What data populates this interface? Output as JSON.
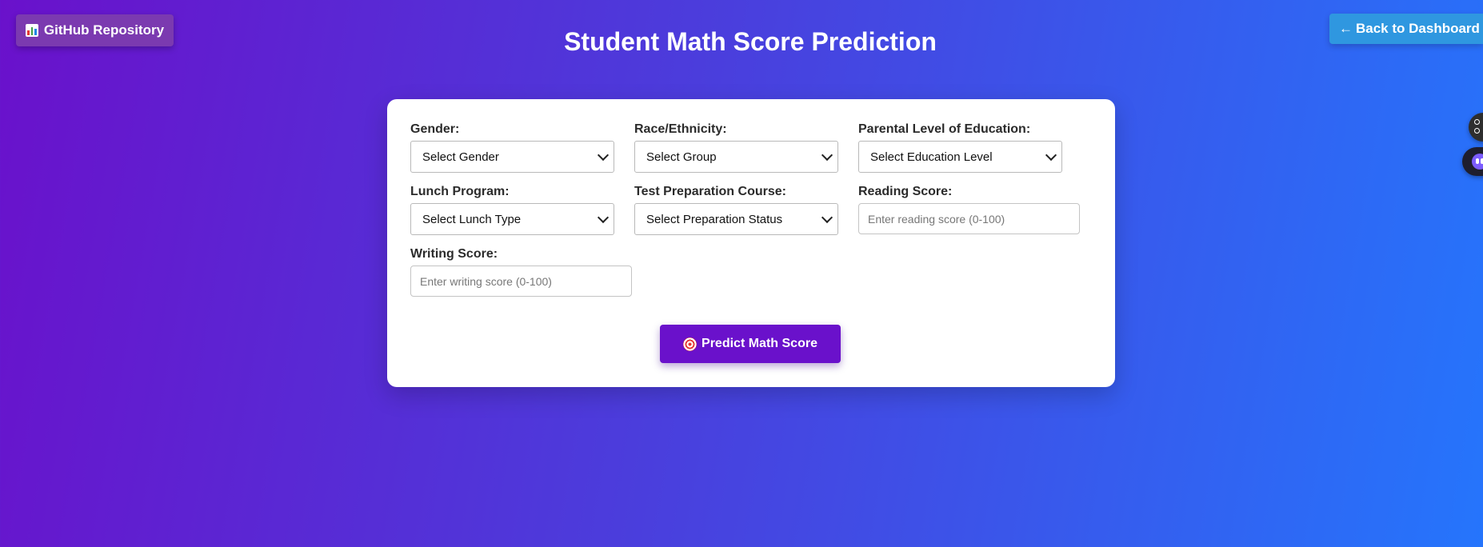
{
  "header": {
    "github_label": "GitHub Repository",
    "back_label": "Back to Dashboard",
    "back_arrow": "←",
    "title": "Student Math Score Prediction"
  },
  "form": {
    "gender": {
      "label": "Gender:",
      "selected": "Select Gender"
    },
    "race": {
      "label": "Race/Ethnicity:",
      "selected": "Select Group"
    },
    "parental": {
      "label": "Parental Level of Education:",
      "selected": "Select Education Level"
    },
    "lunch": {
      "label": "Lunch Program:",
      "selected": "Select Lunch Type"
    },
    "prep": {
      "label": "Test Preparation Course:",
      "selected": "Select Preparation Status"
    },
    "reading": {
      "label": "Reading Score:",
      "placeholder": "Enter reading score (0-100)",
      "value": ""
    },
    "writing": {
      "label": "Writing Score:",
      "placeholder": "Enter writing score (0-100)",
      "value": ""
    },
    "submit_label": "Predict Math Score"
  },
  "icons": {
    "github": "bar-chart-icon",
    "submit": "target-icon",
    "side_widget_1": "widget-menu-icon",
    "side_widget_2": "assistant-bot-icon"
  },
  "colors": {
    "gradient_start": "#6a11cb",
    "gradient_end": "#2575fc",
    "github_button": "#7b3ab0",
    "back_button": "#2f97e0",
    "predict_button": "#6a11cb"
  }
}
